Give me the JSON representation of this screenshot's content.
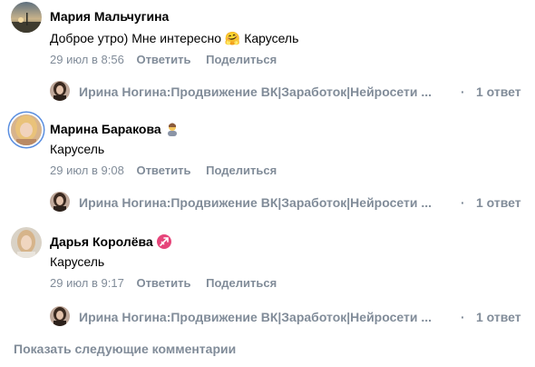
{
  "comments": [
    {
      "author": "Мария Мальчугина",
      "text": "Доброе утро) Мне интересно 🤗 Карусель",
      "time": "29 июл в 8:56",
      "reply_label": "Ответить",
      "share_label": "Поделиться",
      "reply_author": "Ирина Ногина:Продвижение ВК|Заработок|Нейросети ...",
      "reply_separator": "·",
      "reply_count": "1 ответ"
    },
    {
      "author": "Марина Баракова",
      "author_emoji": "🙇‍♀️",
      "text": "Карусель",
      "time": "29 июл в 9:08",
      "reply_label": "Ответить",
      "share_label": "Поделиться",
      "reply_author": "Ирина Ногина:Продвижение ВК|Заработок|Нейросети ...",
      "reply_separator": "·",
      "reply_count": "1 ответ"
    },
    {
      "author": "Дарья Королёва",
      "author_emoji": "♐",
      "text": "Карусель",
      "time": "29 июл в 9:17",
      "reply_label": "Ответить",
      "share_label": "Поделиться",
      "reply_author": "Ирина Ногина:Продвижение ВК|Заработок|Нейросети ...",
      "reply_separator": "·",
      "reply_count": "1 ответ"
    }
  ],
  "show_more": "Показать следующие комментарии",
  "colors": {
    "secondary_text": "#818c99",
    "primary_text": "#000000",
    "avatar_ring": "#5b8fe0",
    "sagittarius_badge": "#e6457a"
  },
  "icons": {
    "avatar_1": "sunset-landscape-avatar",
    "avatar_2": "blonde-woman-avatar",
    "avatar_3": "woman-portrait-avatar",
    "reply_avatar": "brunette-woman-avatar"
  }
}
